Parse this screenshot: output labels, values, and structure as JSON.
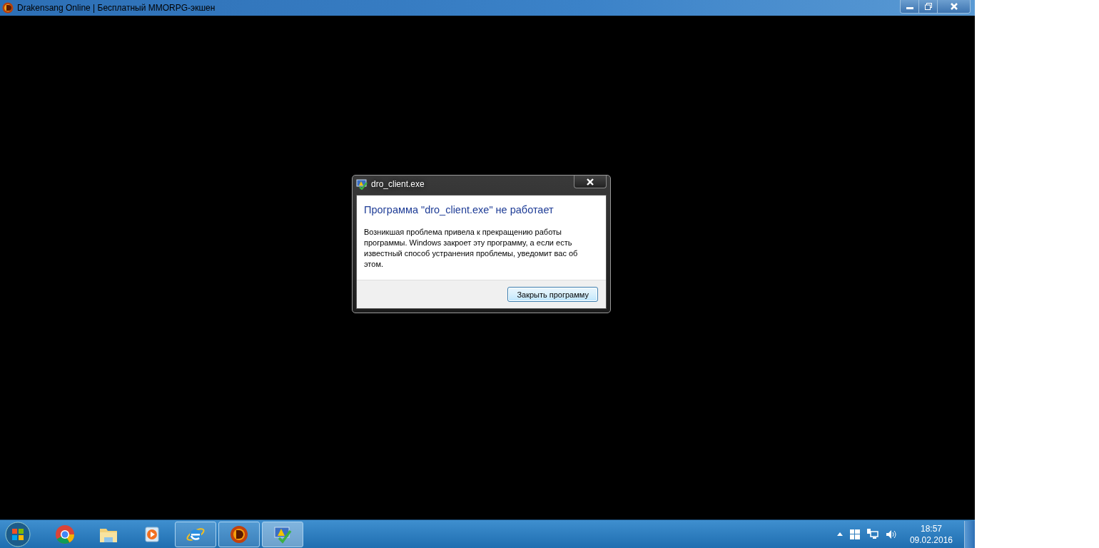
{
  "window": {
    "title": "Drakensang Online | Бесплатный MMORPG-экшен"
  },
  "dialog": {
    "title": "dro_client.exe",
    "heading": "Программа \"dro_client.exe\" не работает",
    "message": "Возникшая проблема привела к прекращению работы программы. Windows закроет эту программу, а если есть известный способ устранения проблемы, уведомит вас об этом.",
    "button": "Закрыть программу"
  },
  "taskbar": {
    "items": [
      {
        "kind": "chrome",
        "running": false,
        "active": false
      },
      {
        "kind": "folder",
        "running": false,
        "active": false
      },
      {
        "kind": "media",
        "running": false,
        "active": false
      },
      {
        "kind": "ie",
        "running": true,
        "active": false
      },
      {
        "kind": "game",
        "running": true,
        "active": false
      },
      {
        "kind": "troubleshoot",
        "running": true,
        "active": true
      }
    ],
    "time": "18:57",
    "date": "09.02.2016"
  }
}
